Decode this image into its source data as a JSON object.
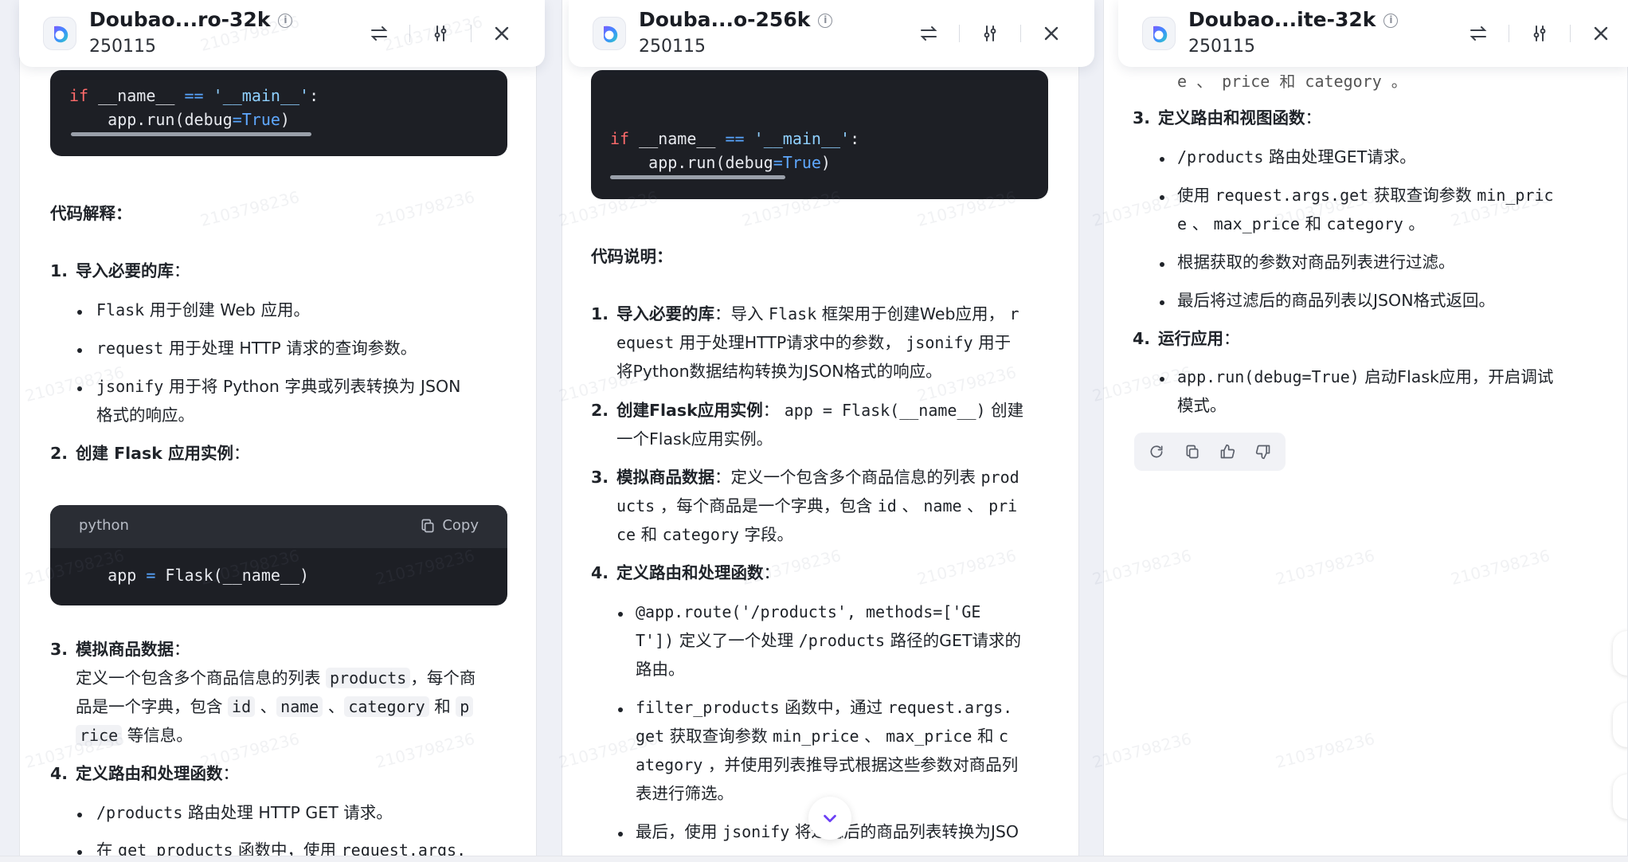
{
  "headers": [
    {
      "title": "Doubao...ro-32k",
      "subtitle": "250115"
    },
    {
      "title": "Douba...o-256k",
      "subtitle": "250115"
    },
    {
      "title": "Doubao...ite-32k",
      "subtitle": "250115"
    }
  ],
  "icons": {
    "logo": "doubao-logo-icon",
    "info": "info-icon",
    "swap": "swap-icon",
    "settings": "sliders-icon",
    "close": "close-icon",
    "copy": "copy-icon",
    "regenerate": "refresh-icon",
    "like": "thumbs-up-icon",
    "dislike": "thumbs-down-icon",
    "scroll": "chevron-down-icon"
  },
  "panel1": {
    "code_top": {
      "line1_kw": "if",
      "line1_a": " __name__ ",
      "line1_op": "==",
      "line1_str": " '__main__'",
      "line1_colon": ":",
      "line2_a": "    app.run(debug",
      "line2_op": "=",
      "line2_bool": "True",
      "line2_end": ")"
    },
    "heading": "代码解释：",
    "item1_num": "1.",
    "item1_title": "导入必要的库",
    "item1_colon": "：",
    "b1_code": "Flask",
    "b1_text": " 用于创建 Web 应用。",
    "b2_code": "request",
    "b2_text": " 用于处理 HTTP 请求的查询参数。",
    "b3_code": "jsonify",
    "b3_text": " 用于将 Python 字典或列表转换为 JSON",
    "b3_text2": "格式的响应。",
    "item2_num": "2.",
    "item2_title": "创建 Flask 应用实例",
    "item2_colon": "：",
    "code2": {
      "lang": "python",
      "copy_label": "Copy",
      "l_a": "    app ",
      "l_op": "=",
      "l_b": " Flask(__name__)"
    },
    "item3_num": "3.",
    "item3_title": "模拟商品数据",
    "item3_colon": "：",
    "item3_l1a": "定义一个包含多个商品信息的列表 ",
    "item3_l1code": "products",
    "item3_l1b": "，每个商",
    "item3_l2a": "品是一个字典，包含 ",
    "item3_l2c1": "id",
    "item3_l2s1": " 、",
    "item3_l2c2": "name",
    "item3_l2s2": " 、",
    "item3_l2c3": "category",
    "item3_l2s3": " 和 ",
    "item3_l2c4": "p",
    "item3_l3code": "rice",
    "item3_l3b": " 等信息。",
    "item4_num": "4.",
    "item4_title": "定义路由和处理函数",
    "item4_colon": "：",
    "b4_code": "/products",
    "b4_text": " 路由处理 HTTP GET 请求。",
    "b5_text": "在 ",
    "b5_code": "get_products",
    "b5_text2": " 函数中，使用 ",
    "b5_code2": "request.args."
  },
  "panel2": {
    "code_top": {
      "line1_kw": "if",
      "line1_a": " __name__ ",
      "line1_op": "==",
      "line1_str": " '__main__'",
      "line1_colon": ":",
      "line2_a": "    app.run(debug",
      "line2_op": "=",
      "line2_bool": "True",
      "line2_end": ")"
    },
    "heading": "代码说明：",
    "i1_num": "1.",
    "i1_title": "导入必要的库",
    "i1_l1a": "：导入 ",
    "i1_l1code": "Flask",
    "i1_l1b": " 框架用于创建Web应用， ",
    "i1_l1code2": "r",
    "i1_l2code": "equest",
    "i1_l2b": " 用于处理HTTP请求中的参数， ",
    "i1_l2code2": "jsonify",
    "i1_l2c": " 用于",
    "i1_l3": "将Python数据结构转换为JSON格式的响应。",
    "i2_num": "2.",
    "i2_title": "创建Flask应用实例",
    "i2_l1a": "： ",
    "i2_l1code": "app = Flask(__name__)",
    "i2_l1b": " 创建",
    "i2_l2": "一个Flask应用实例。",
    "i3_num": "3.",
    "i3_title": "模拟商品数据",
    "i3_l1a": "：定义一个包含多个商品信息的列表 ",
    "i3_l1code": "prod",
    "i3_l2code": "ucts",
    "i3_l2b": " ，每个商品是一个字典，包含 ",
    "i3_l2c1": "id",
    "i3_l2s1": " 、 ",
    "i3_l2c2": "name",
    "i3_l2s2": " 、 ",
    "i3_l2c3": "pri",
    "i3_l3code": "ce",
    "i3_l3b": " 和 ",
    "i3_l3code2": "category",
    "i3_l3c": " 字段。",
    "i4_num": "4.",
    "i4_title": "定义路由和处理函数",
    "i4_colon": "：",
    "b1_l1code": "@app.route('/products', methods=['GE",
    "b1_l2code": "T'])",
    "b1_l2b": " 定义了一个处理 ",
    "b1_l2code2": "/products",
    "b1_l2c": " 路径的GET请求的",
    "b1_l3": "路由。",
    "b2_l1code": "filter_products",
    "b2_l1b": " 函数中，通过 ",
    "b2_l1code2": "request.args.",
    "b2_l2code": "get",
    "b2_l2b": " 获取查询参数 ",
    "b2_l2code2": "min_price",
    "b2_l2s": " 、 ",
    "b2_l2code3": "max_price",
    "b2_l2c": " 和 ",
    "b2_l2code4": "c",
    "b2_l3code": "ategory",
    "b2_l3b": " ，并使用列表推导式根据这些参数对商品列",
    "b2_l4": "表进行筛选。",
    "b3_l1a": "最后，使用 ",
    "b3_l1code": "jsonify",
    "b3_l1b": " 将过滤后的商品列表转换为JSO"
  },
  "panel3": {
    "top_partial": "e 、 price 和 category 。",
    "i3_num": "3.",
    "i3_title": "定义路由和视图函数",
    "i3_colon": "：",
    "b1_code": "/products",
    "b1_text": " 路由处理GET请求。",
    "b2_a": "使用 ",
    "b2_code": "request.args.get",
    "b2_b": " 获取查询参数 ",
    "b2_code2": "min_pric",
    "b2_l2code": "e",
    "b2_l2a": " 、 ",
    "b2_l2code2": "max_price",
    "b2_l2b": " 和 ",
    "b2_l2code3": "category",
    "b2_l2c": " 。",
    "b3_text": "根据获取的参数对商品列表进行过滤。",
    "b4_text": "最后将过滤后的商品列表以JSON格式返回。",
    "i4_num": "4.",
    "i4_title": "运行应用",
    "i4_colon": "：",
    "b5_code": "app.run(debug=True)",
    "b5_text": " 启动Flask应用，开启调试",
    "b5_text2": "模式。"
  },
  "watermark": "2103798236"
}
